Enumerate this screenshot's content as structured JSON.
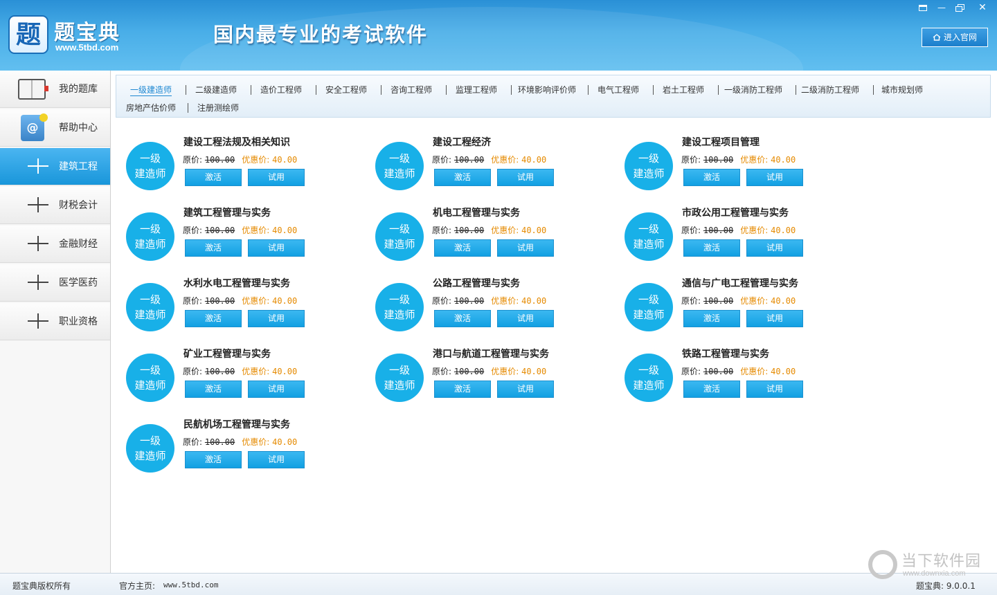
{
  "header": {
    "logo_char": "题",
    "app_name": "题宝典",
    "site_url": "www.5tbd.com",
    "slogan": "国内最专业的考试软件",
    "enter_site_label": "进入官网"
  },
  "window_controls": {
    "minimize": "—",
    "close": "✕"
  },
  "sidebar": {
    "items": [
      {
        "label": "我的题库",
        "icon": "book-icon"
      },
      {
        "label": "帮助中心",
        "icon": "help-book-icon",
        "glyph": "@"
      },
      {
        "label": "建筑工程",
        "icon": "plus-icon",
        "active": true
      },
      {
        "label": "财税会计",
        "icon": "plus-icon"
      },
      {
        "label": "金融财经",
        "icon": "plus-icon"
      },
      {
        "label": "医学医药",
        "icon": "plus-icon"
      },
      {
        "label": "职业资格",
        "icon": "plus-icon"
      }
    ]
  },
  "categories": [
    "一级建造师",
    "二级建造师",
    "造价工程师",
    "安全工程师",
    "咨询工程师",
    "监理工程师",
    "环境影响评价师",
    "电气工程师",
    "岩土工程师",
    "一级消防工程师",
    "二级消防工程师",
    "城市规划师",
    "房地产估价师",
    "注册测绘师"
  ],
  "active_category": "一级建造师",
  "product_labels": {
    "badge_line1": "一级",
    "badge_line2": "建造师",
    "orig_label": "原价:",
    "orig_price": "100.00",
    "sale_label": "优惠价:",
    "sale_price": "40.00",
    "activate": "激活",
    "trial": "试用"
  },
  "products": [
    "建设工程法规及相关知识",
    "建设工程经济",
    "建设工程项目管理",
    "建筑工程管理与实务",
    "机电工程管理与实务",
    "市政公用工程管理与实务",
    "水利水电工程管理与实务",
    "公路工程管理与实务",
    "通信与广电工程管理与实务",
    "矿业工程管理与实务",
    "港口与航道工程管理与实务",
    "铁路工程管理与实务",
    "民航机场工程管理与实务"
  ],
  "statusbar": {
    "copyright": "题宝典版权所有",
    "homepage_label": "官方主页:",
    "homepage_url": "www.5tbd.com",
    "version": "题宝典: 9.0.0.1"
  },
  "watermark": {
    "title": "当下软件园",
    "url": "www.downxia.com"
  },
  "colors": {
    "header_blue": "#49aee8",
    "badge_blue": "#18b0e8",
    "sale_orange": "#e58a00"
  }
}
